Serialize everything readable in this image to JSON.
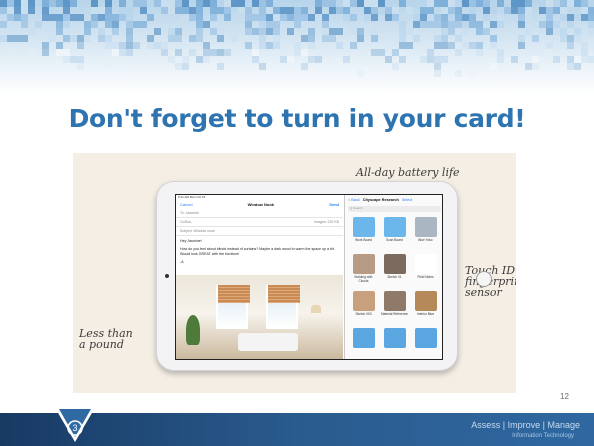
{
  "slide": {
    "title": "Don't forget to turn in your card!",
    "page_number": "12"
  },
  "photo": {
    "annotations": {
      "battery": "All-day battery life",
      "touch_id": "Touch ID fingerprint sensor",
      "weight": "Less than a pound"
    },
    "mail": {
      "status": "9:41 AM  Mon Oct 15",
      "cancel": "Cancel",
      "subject_title": "Window Nook",
      "send": "Send",
      "to": "To: Jasmine",
      "cc": "Cc/Bcc,",
      "images": "Images: 220 KB",
      "subject": "Subject: Window nook",
      "greeting": "Hey Jasmine!",
      "message": "How do you feel about blinds instead of curtains? Maybe a dark wood to warm the space up a bit. Would look GREAT with the furniture!",
      "signoff": "-A"
    },
    "files": {
      "back": "< Back",
      "title": "Cityscape Research",
      "select": "Select",
      "search": "Q Search",
      "items": [
        "Work Board",
        "Scan Board",
        "Blue Yoko",
        "Building with Clouds",
        "Sketch 01",
        "Field Notes",
        "Sketch 003",
        "Material Reference",
        "Interior Blue",
        "",
        "",
        ""
      ]
    }
  },
  "footer": {
    "tagline": "Assess | Improve | Manage",
    "subtitle": "Information Technology",
    "logo_letter": "3"
  }
}
